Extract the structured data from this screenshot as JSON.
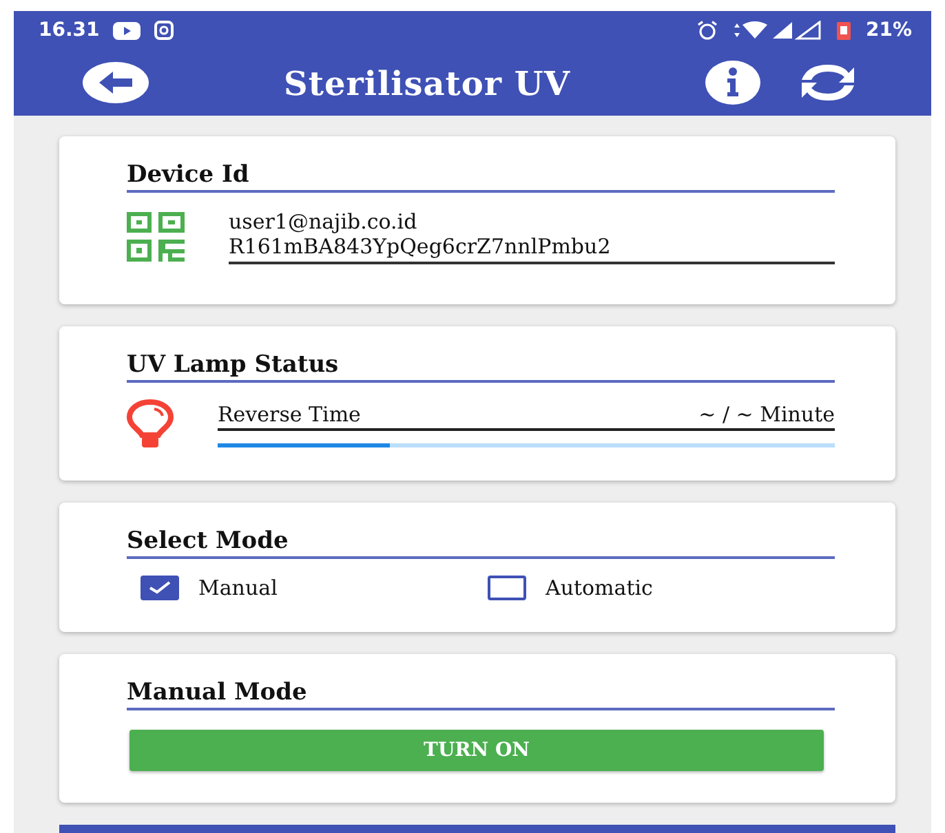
{
  "status_bar": {
    "time": "16.31",
    "battery": "21%"
  },
  "app_bar": {
    "title": "Sterilisator UV"
  },
  "device_card": {
    "title": "Device Id",
    "email": "user1@najib.co.id",
    "device_id": "R161mBA843YpQeg6crZ7nnlPmbu2"
  },
  "lamp_card": {
    "title": "UV Lamp Status",
    "label": "Reverse Time",
    "reading": "~ / ~ Minute",
    "level": 0.28
  },
  "mode_card": {
    "title": "Select Mode",
    "options": [
      {
        "label": "Manual",
        "selected": true
      },
      {
        "label": "Automatic",
        "selected": false
      }
    ]
  },
  "manual_card": {
    "title": "Manual Mode",
    "button": "TURN ON"
  }
}
